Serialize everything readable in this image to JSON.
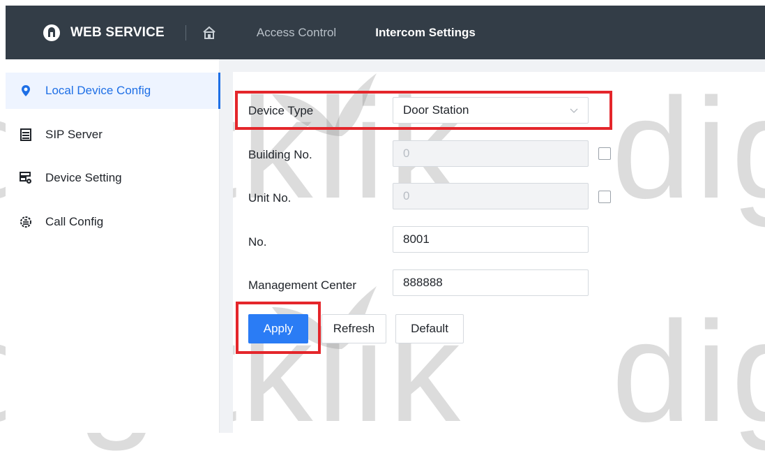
{
  "header": {
    "brand": "WEB SERVICE",
    "nav": [
      "Access Control",
      "Intercom Settings"
    ],
    "active_nav": "Intercom Settings"
  },
  "sidebar": {
    "items": [
      {
        "label": "Local Device Config",
        "icon": "location-pin-icon",
        "active": true
      },
      {
        "label": "SIP Server",
        "icon": "server-icon",
        "active": false
      },
      {
        "label": "Device Setting",
        "icon": "device-setting-icon",
        "active": false
      },
      {
        "label": "Call Config",
        "icon": "call-config-icon",
        "active": false
      }
    ]
  },
  "form": {
    "device_type": {
      "label": "Device Type",
      "value": "Door Station"
    },
    "building_no": {
      "label": "Building No.",
      "value": "0",
      "checked": false
    },
    "unit_no": {
      "label": "Unit No.",
      "value": "0",
      "checked": false
    },
    "no": {
      "label": "No.",
      "value": "8001"
    },
    "management_center": {
      "label": "Management Center",
      "value": "888888"
    }
  },
  "buttons": {
    "apply": "Apply",
    "refresh": "Refresh",
    "default": "Default"
  },
  "watermark": "digitklik",
  "colors": {
    "header_bg": "#333d47",
    "accent": "#2a7cf5",
    "highlight": "#e4262b"
  }
}
